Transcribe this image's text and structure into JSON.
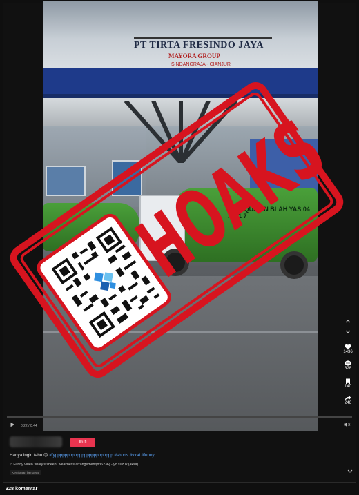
{
  "video": {
    "sign_title": "PT TIRTA FRESINDO JAYA",
    "sign_subtitle": "MAYORA GROUP",
    "sign_location": "SINDANGRAJA - CIANJUR",
    "tank_text": "N AL-QUR'AN   BLAH  YAS   04 ... 41 7"
  },
  "stamp": {
    "text": "HOAKS"
  },
  "player": {
    "time": "0:22 / 0:44",
    "progress_fraction": 0.5
  },
  "actions": {
    "likes": "1436",
    "comments": "328",
    "saves": "140",
    "shares": "246"
  },
  "meta": {
    "join_label": "Ikuti",
    "caption_text": "Hanya ingin tahu 😊 ",
    "caption_tags": "#fypppppppppppppppppppppppp #shorts #viral #funny",
    "music": "♫ Funny video \"Mary's sheep\" weakness arrangement(836236) - yo suzuki(aksa)",
    "note": "Kemitraan berbayar",
    "comment_count": "328 komentar"
  },
  "colors": {
    "stamp_red": "#d7141f",
    "join_button": "#e8344f",
    "hashtag_blue": "#5ea8ff"
  }
}
